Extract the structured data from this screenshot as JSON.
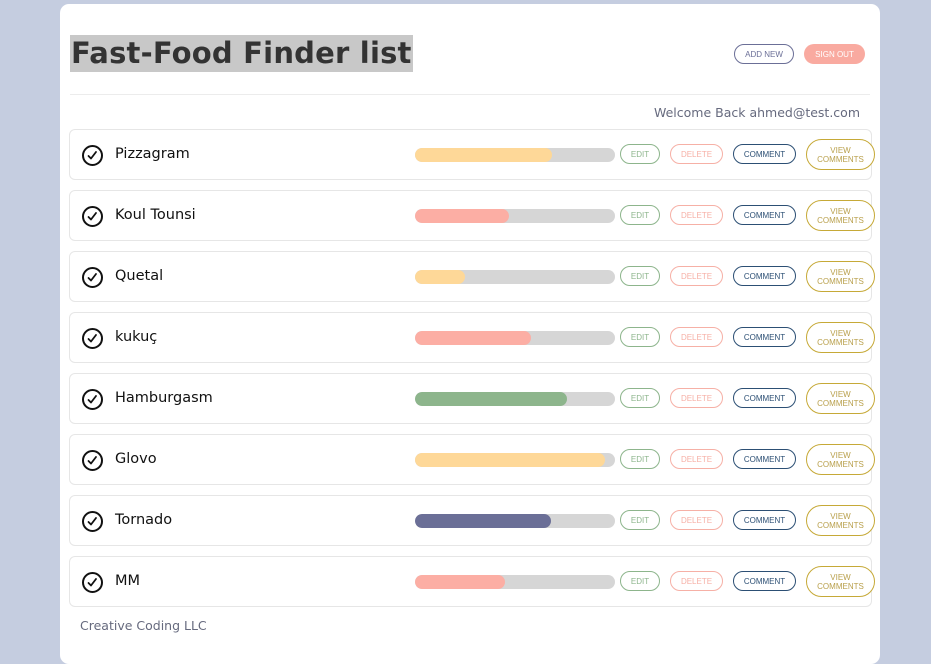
{
  "header": {
    "title": "Fast-Food Finder list",
    "add_label": "ADD NEW",
    "signout_label": "SIGN OUT",
    "welcome": "Welcome Back ahmed@test.com"
  },
  "row_buttons": {
    "edit": "EDIT",
    "delete": "DELETE",
    "comment": "COMMENT",
    "view_line1": "VIEW",
    "view_line2": "COMMENTS"
  },
  "colors": {
    "orange": "#fed898",
    "pink": "#fcaea4",
    "green": "#8db58c",
    "navy": "#6b6f97",
    "track": "#d6d6d6"
  },
  "items": [
    {
      "name": "Pizzagram",
      "rating": 0.685,
      "color": "#fed898"
    },
    {
      "name": "Koul Tounsi",
      "rating": 0.47,
      "color": "#fcaea4"
    },
    {
      "name": "Quetal",
      "rating": 0.25,
      "color": "#fed898"
    },
    {
      "name": "kukuç",
      "rating": 0.58,
      "color": "#fcaea4"
    },
    {
      "name": "Hamburgasm",
      "rating": 0.76,
      "color": "#8db58c"
    },
    {
      "name": "Glovo",
      "rating": 0.95,
      "color": "#fed898"
    },
    {
      "name": "Tornado",
      "rating": 0.68,
      "color": "#6b6f97"
    },
    {
      "name": "MM",
      "rating": 0.45,
      "color": "#fcaea4"
    }
  ],
  "footer": {
    "text": "Creative Coding LLC"
  }
}
